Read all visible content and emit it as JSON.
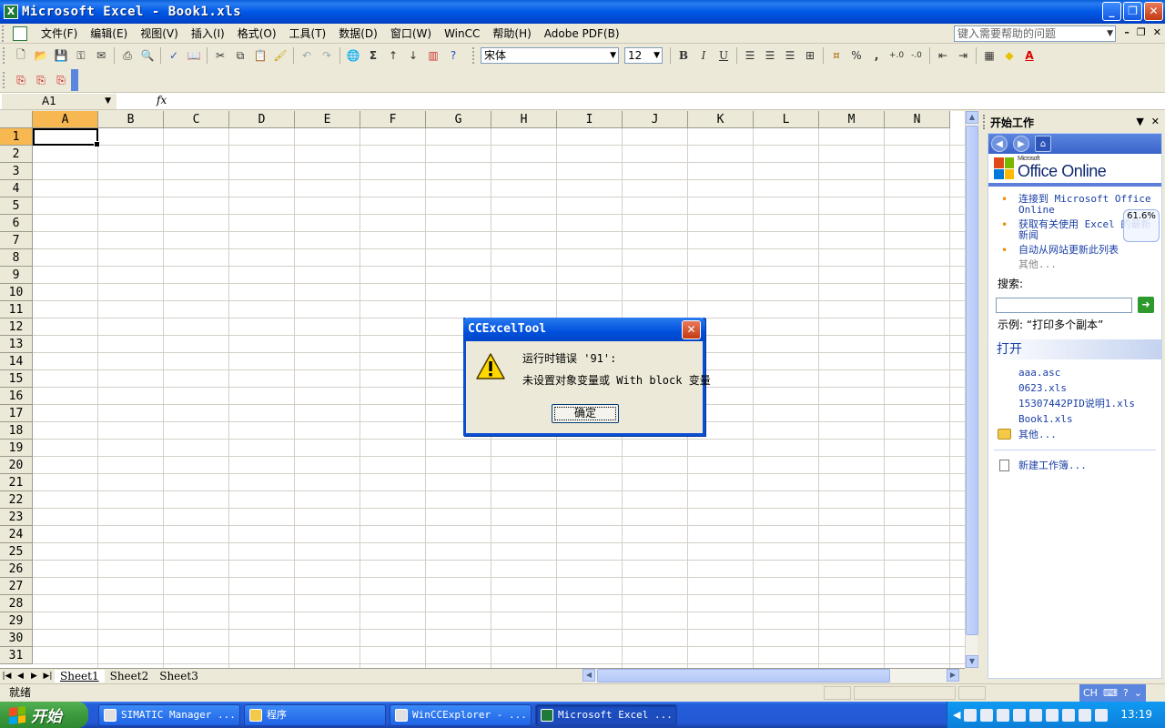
{
  "window": {
    "title": "Microsoft Excel - Book1.xls",
    "icon_name": "excel-icon"
  },
  "menu": {
    "items": [
      "文件(F)",
      "编辑(E)",
      "视图(V)",
      "插入(I)",
      "格式(O)",
      "工具(T)",
      "数据(D)",
      "窗口(W)",
      "WinCC",
      "帮助(H)",
      "Adobe PDF(B)"
    ],
    "help_placeholder": "键入需要帮助的问题"
  },
  "format_toolbar": {
    "font_name": "宋体",
    "font_size": "12",
    "bold": "B",
    "italic": "I",
    "underline": "U",
    "percent": "%",
    "comma": ","
  },
  "formula_bar": {
    "name_box": "A1",
    "fx": "fx"
  },
  "grid": {
    "columns": [
      "A",
      "B",
      "C",
      "D",
      "E",
      "F",
      "G",
      "H",
      "I",
      "J",
      "K",
      "L",
      "M",
      "N"
    ],
    "rows": [
      "1",
      "2",
      "3",
      "4",
      "5",
      "6",
      "7",
      "8",
      "9",
      "10",
      "11",
      "12",
      "13",
      "14",
      "15",
      "16",
      "17",
      "18",
      "19",
      "20",
      "21",
      "22",
      "23",
      "24",
      "25",
      "26",
      "27",
      "28",
      "29",
      "30",
      "31"
    ],
    "active_cell": "A1"
  },
  "sheets": {
    "tabs": [
      "Sheet1",
      "Sheet2",
      "Sheet3"
    ],
    "active": "Sheet1"
  },
  "task_pane": {
    "title": "开始工作",
    "office_small": "Microsoft",
    "office_brand": "Office Online",
    "links": [
      "连接到 Microsoft Office Online",
      "获取有关使用 Excel 的最新新闻",
      "自动从网站更新此列表"
    ],
    "more": "其他...",
    "zoom_badge": "61.6%",
    "search_label": "搜索:",
    "example": "示例: “打印多个副本”",
    "open_title": "打开",
    "recent_files": [
      "aaa.asc",
      "0623.xls",
      "15307442PID说明1.xls",
      "Book1.xls"
    ],
    "open_more": "其他...",
    "new_workbook": "新建工作簿..."
  },
  "status_bar": {
    "text": "就绪",
    "ime": "CH"
  },
  "dialog": {
    "title": "CCExcelTool",
    "line1": "运行时错误 '91':",
    "line2": "未设置对象变量或 With block 变量",
    "ok_label": "确定"
  },
  "taskbar": {
    "start_label": "开始",
    "tasks": [
      "SIMATIC Manager ...",
      "程序",
      "WinCCExplorer - ...",
      "Microsoft Excel ..."
    ],
    "active_task": "Microsoft Excel ...",
    "clock": "13:19"
  },
  "colors": {
    "titlebar_blue": "#0058e6",
    "active_header": "#f7b851",
    "start_green": "#3c9a3c"
  }
}
